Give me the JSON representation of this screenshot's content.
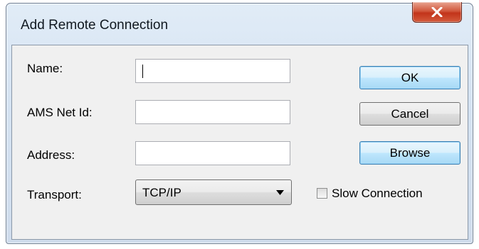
{
  "window": {
    "title": "Add Remote Connection",
    "close_icon": "close-icon"
  },
  "form": {
    "name_label": "Name:",
    "name_value": "",
    "ams_label": "AMS Net Id:",
    "ams_value": "",
    "address_label": "Address:",
    "address_value": "",
    "transport_label": "Transport:",
    "transport_value": "TCP/IP"
  },
  "buttons": {
    "ok": "OK",
    "cancel": "Cancel",
    "browse": "Browse"
  },
  "options": {
    "slow_connection_label": "Slow Connection",
    "slow_connection_checked": false
  },
  "colors": {
    "close_button": "#c8402a",
    "default_button_border": "#3c7fb1"
  }
}
